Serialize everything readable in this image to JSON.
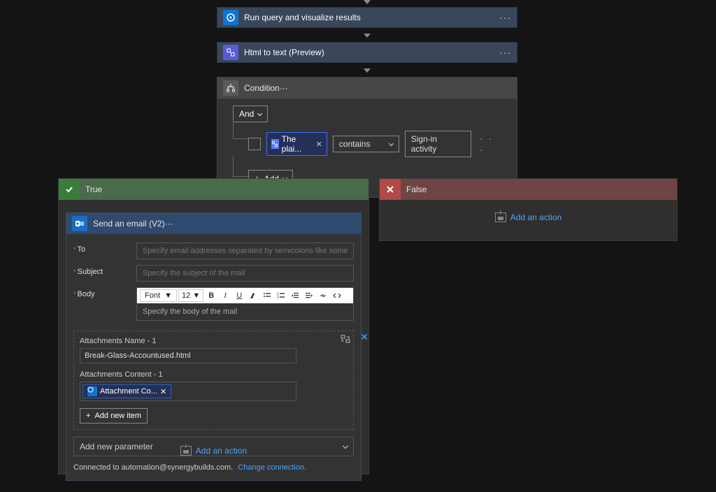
{
  "steps": {
    "run_query": "Run query and visualize results",
    "html_to_text": "Html to text (Preview)",
    "condition": "Condition"
  },
  "condition": {
    "logic": "And",
    "row": {
      "token": "The plai...",
      "operator": "contains",
      "value": "Sign-in activity"
    },
    "add_label": "Add"
  },
  "branches": {
    "true_label": "True",
    "false_label": "False"
  },
  "email": {
    "title": "Send an email (V2)",
    "fields": {
      "to_label": "To",
      "to_placeholder": "Specify email addresses separated by semicolons like someone@contoso.com",
      "subject_label": "Subject",
      "subject_placeholder": "Specify the subject of the mail",
      "body_label": "Body",
      "body_placeholder": "Specify the body of the mail"
    },
    "rte": {
      "font_label": "Font",
      "size_label": "12"
    },
    "attachments": {
      "name_label": "Attachments Name - 1",
      "name_value": "Break-Glass-Accountused.html",
      "content_label": "Attachments Content - 1",
      "content_token": "Attachment Co...",
      "add_item": "Add new item"
    },
    "param_label": "Add new parameter",
    "connection_prefix": "Connected to automation@synergybuilds.com.",
    "change_connection": "Change connection."
  },
  "add_action": "Add an action"
}
